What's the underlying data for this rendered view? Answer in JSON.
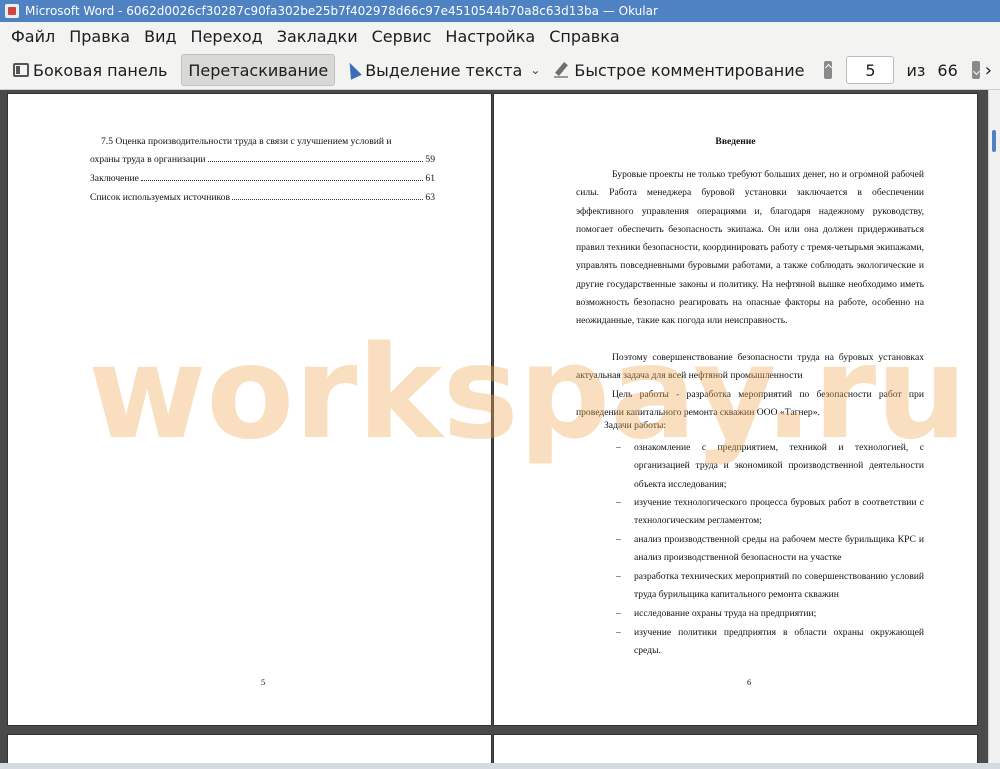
{
  "window": {
    "title": "Microsoft Word - 6062d0026cf30287c90fa302be25b7f402978d66c97e4510544b70a8c63d13ba  — Okular"
  },
  "menubar": {
    "items": [
      "Файл",
      "Правка",
      "Вид",
      "Переход",
      "Закладки",
      "Сервис",
      "Настройка",
      "Справка"
    ]
  },
  "toolbar": {
    "sidebar_label": "Боковая панель",
    "drag_label": "Перетаскивание",
    "text_select_label": "Выделение текста",
    "quick_annotate_label": "Быстрое комментирование",
    "current_page": "5",
    "of_label": "из",
    "total_pages": "66",
    "overflow": "›"
  },
  "pages": {
    "left": {
      "toc": [
        {
          "text": "7.5 Оценка производительности труда в связи с улучшением условий и",
          "page": ""
        },
        {
          "text": "охраны труда в организации",
          "page": "59"
        },
        {
          "text": "Заключение",
          "page": "61"
        },
        {
          "text": "Список используемых источников",
          "page": "63"
        }
      ],
      "page_number": "5"
    },
    "right": {
      "title": "Введение",
      "paragraphs": [
        "Буровые проекты не только требуют больших денег, но и огромной рабочей силы. Работа менеджера буровой установки заключается в обеспечении эффективного управления операциями и, благодаря надежному руководству, помогает обеспечить безопасность экипажа. Он или она должен придерживаться правил техники безопасности, координировать работу с тремя-четырьмя экипажами, управлять повседневными буровыми работами, а также соблюдать экологические и другие государственные законы и политику. На нефтяной вышке необходимо иметь возможность безопасно реагировать на опасные факторы на работе, особенно на неожиданные, такие как погода или неисправность.",
        "Поэтому совершенствование безопасности труда на буровых установках актуальная задача для всей нефтяной промышленности",
        "Цель работы - разработка мероприятий по безопасности работ при проведении капитального ремонта скважин ООО «Тагнер»."
      ],
      "tasks_header": "Задачи работы:",
      "tasks": [
        "ознакомление с предприятием, техникой и технологией, с организацией труда и экономикой производственной деятельности объекта исследования;",
        "изучение технологического процесса буровых работ в соответствии с технологическим регламентом;",
        "анализ производственной среды на рабочем месте бурильщика КРС и анализ производственной безопасности на участке",
        "разработка технических мероприятий по совершенствованию условий труда бурильщика капитального ремонта скважин",
        "исследование охраны труда на предприятии;",
        "изучение политики предприятия в области охраны окружающей среды."
      ],
      "page_number": "6"
    }
  },
  "watermark": "workspay.ru"
}
